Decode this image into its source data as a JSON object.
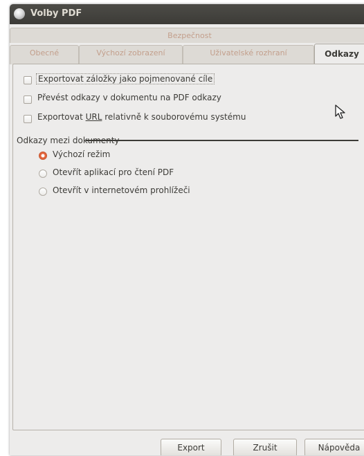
{
  "window": {
    "title": "Volby PDF"
  },
  "tabs_row1": [
    {
      "label": "Bezpečnost"
    }
  ],
  "tabs_row2": [
    {
      "label": "Obecné"
    },
    {
      "label": "Výchozí zobrazení"
    },
    {
      "label": "Uživatelské rozhraní"
    },
    {
      "label": "Odkazy",
      "active": true
    }
  ],
  "options": {
    "export_bookmarks": {
      "label": "Exportovat záložky jako pojmenované cíle",
      "checked": false
    },
    "convert_links": {
      "label": "Převést odkazy v dokumentu na PDF odkazy",
      "checked": false
    },
    "export_url_relative": {
      "label_pre": "Exportovat ",
      "label_u": "URL",
      "label_post": " relativně k souborovému systému",
      "checked": false
    }
  },
  "cross_doc": {
    "title": "Odkazy mezi dokumenty",
    "default_mode": {
      "label": "Výchozí režim",
      "selected": true
    },
    "open_pdf_reader": {
      "label": "Otevřít aplikací pro čtení PDF",
      "selected": false
    },
    "open_browser": {
      "label": "Otevřít v internetovém prohlížeči",
      "selected": false
    }
  },
  "buttons": {
    "export": "Export",
    "cancel": "Zrušit",
    "help": "Nápověda"
  },
  "colors": {
    "titlebar": "#3c3b37",
    "radio_accent": "#e3643a",
    "inactive_tab_text": "#c39f8c"
  }
}
